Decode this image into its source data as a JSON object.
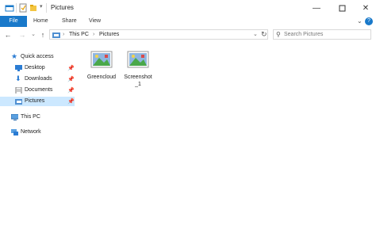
{
  "window": {
    "title": "Pictures",
    "minimize_icon": "minimize-icon",
    "maximize_icon": "maximize-icon",
    "close_icon": "close-icon"
  },
  "ribbon": {
    "tabs": [
      {
        "label": "File",
        "active": true
      },
      {
        "label": "Home"
      },
      {
        "label": "Share"
      },
      {
        "label": "View"
      }
    ],
    "accent_color": "#1979ca"
  },
  "navigation": {
    "breadcrumb": [
      "This PC",
      "Pictures"
    ],
    "search_placeholder": "Search Pictures"
  },
  "sidebar": {
    "quick_access": "Quick access",
    "items": [
      {
        "label": "Desktop",
        "pinned": true
      },
      {
        "label": "Downloads",
        "pinned": true
      },
      {
        "label": "Documents",
        "pinned": true
      },
      {
        "label": "Pictures",
        "pinned": true,
        "selected": true
      }
    ],
    "this_pc": "This PC",
    "network": "Network"
  },
  "files": [
    {
      "name": "Greencloud"
    },
    {
      "name": "Screenshot\n_1"
    }
  ]
}
